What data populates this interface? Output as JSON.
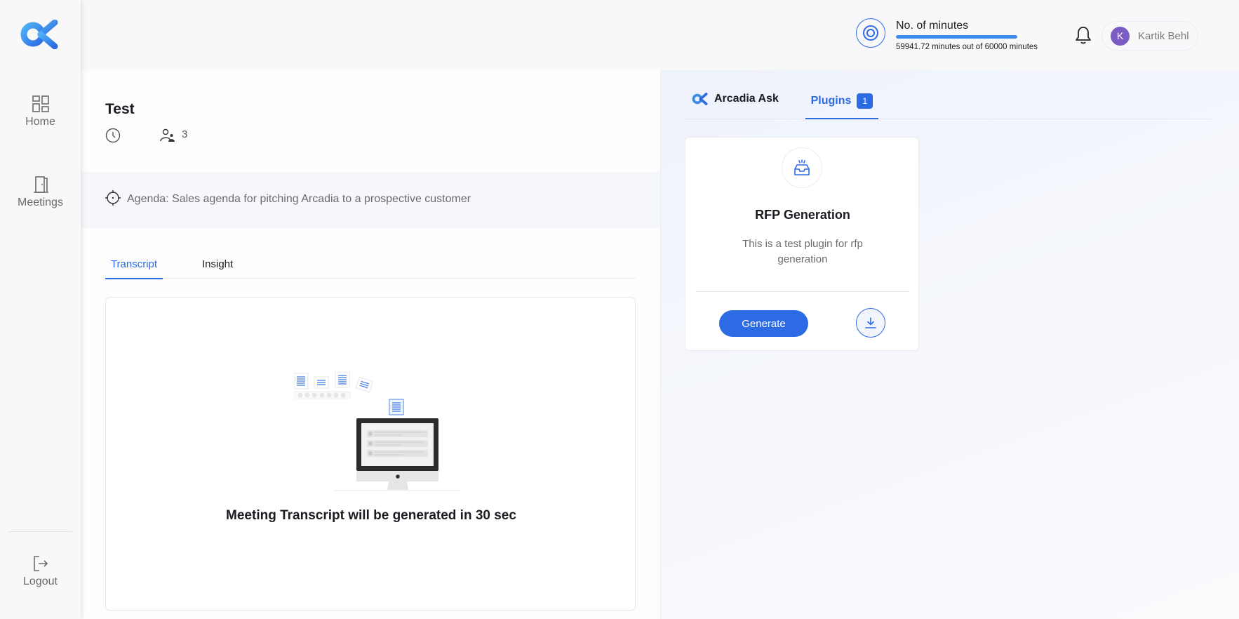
{
  "sidebar": {
    "logo": "arcadia-logo",
    "items": [
      {
        "label": "Home",
        "icon": "grid-icon"
      },
      {
        "label": "Meetings",
        "icon": "door-icon"
      }
    ],
    "logout": {
      "label": "Logout",
      "icon": "logout-icon"
    }
  },
  "header": {
    "usage": {
      "title": "No. of minutes",
      "used": 59941.72,
      "total": 60000,
      "summary": "59941.72 minutes out of 60000 minutes",
      "fraction_used": 0.999
    },
    "user": {
      "initial": "K",
      "name": "Kartik Behl",
      "avatar_color": "#7a5cc2"
    }
  },
  "meeting": {
    "title": "Test",
    "duration": "",
    "participants": "3",
    "agenda": "Agenda: Sales agenda for pitching Arcadia to a prospective customer",
    "tabs": [
      {
        "label": "Transcript",
        "active": true
      },
      {
        "label": "Insight",
        "active": false
      }
    ],
    "transcript_message": "Meeting Transcript will be generated in 30 sec"
  },
  "right_panel": {
    "tabs": [
      {
        "label": "Arcadia Ask",
        "active": false
      },
      {
        "label": "Plugins",
        "active": true,
        "badge": "1"
      }
    ],
    "plugins": [
      {
        "title": "RFP Generation",
        "description": "This is a test plugin for rfp generation",
        "generate_label": "Generate",
        "icon": "inbox-alert-icon"
      }
    ]
  },
  "colors": {
    "accent": "#2d6be4",
    "progress": "#3b8ded"
  }
}
